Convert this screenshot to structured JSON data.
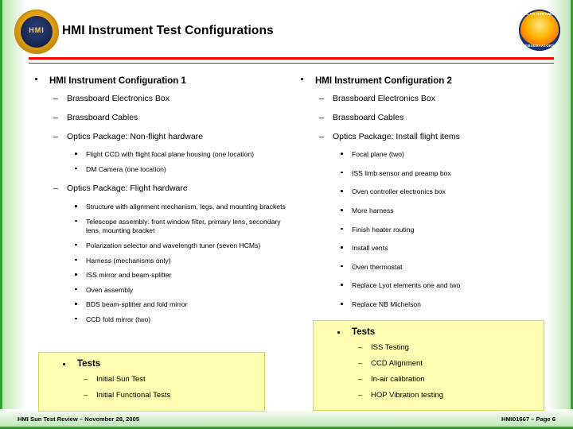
{
  "slide": {
    "title": "HMI Instrument Test Configurations",
    "footer_left": "HMI Sun Test Review – November 28, 2005",
    "footer_right": "HMI01667 – Page 6",
    "logo_hmi_text": "HMI",
    "logo_sdo_top": "SOLAR DYNAMICS",
    "logo_sdo_bottom": "OBSERVATORY",
    "accent_color": "#ff0000",
    "frame_color": "#2fa02f",
    "tests_box_color": "#ffffb3"
  },
  "column_left": {
    "heading": "HMI Instrument Configuration 1",
    "items": [
      {
        "dash": "–",
        "label": "Brassboard Electronics Box",
        "subitems": []
      },
      {
        "dash": "–",
        "label": "Brassboard Cables",
        "subitems": []
      },
      {
        "dash": "–",
        "label": "Optics Package: Non-flight hardware",
        "subitems": [
          "Flight CCD with flight focal plane housing (one location)",
          "DM Camera (one location)"
        ]
      },
      {
        "dash": "–",
        "label": "Optics Package: Flight hardware",
        "subitems": [
          "Structure with alignment mechanism, legs, and mounting brackets",
          "Telescope assembly: front window filter, primary lens, secondary lens, mounting bracket",
          "Polarization selector and wavelength tuner (seven HCMs)",
          "Harness (mechanisms only)",
          "ISS mirror and beam-splitter",
          "Oven assembly",
          "BDS beam-splitter and fold mirror",
          "CCD fold mirror (two)"
        ]
      }
    ],
    "tests": {
      "heading": "Tests",
      "items": [
        "Initial Sun Test",
        "Initial Functional Tests"
      ]
    }
  },
  "column_right": {
    "heading": "HMI Instrument Configuration 2",
    "items": [
      {
        "dash": "–",
        "label": "Brassboard Electronics Box",
        "subitems": []
      },
      {
        "dash": "–",
        "label": "Brassboard Cables",
        "subitems": []
      },
      {
        "dash": "–",
        "label": "Optics Package: Install flight items",
        "subitems": [
          "Focal plane (two)",
          "ISS limb sensor and preamp box",
          "Oven controller electronics box",
          "More harness",
          "Finish heater routing",
          "Install vents",
          "Oven thermostat",
          "Replace Lyot elements one and two",
          "Replace NB Michelson"
        ]
      }
    ],
    "tests": {
      "heading": "Tests",
      "items": [
        "ISS Testing",
        "CCD Alignment",
        "In-air calibration",
        "HOP Vibration testing"
      ]
    }
  }
}
